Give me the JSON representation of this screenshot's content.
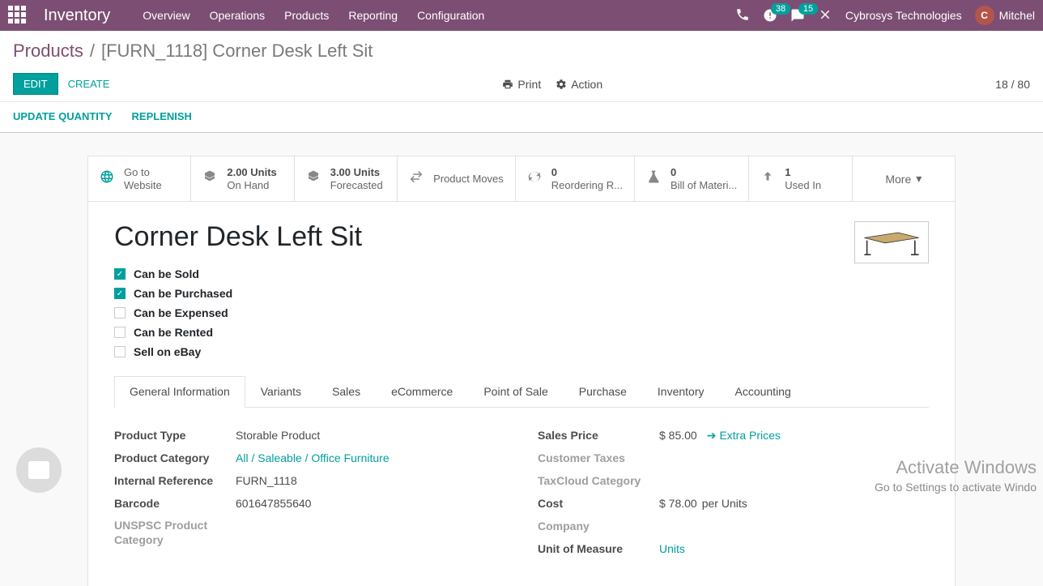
{
  "navbar": {
    "brand": "Inventory",
    "menu": [
      "Overview",
      "Operations",
      "Products",
      "Reporting",
      "Configuration"
    ],
    "activity_count": "38",
    "msg_count": "15",
    "company": "Cybrosys Technologies",
    "user": "Mitchel"
  },
  "breadcrumb": {
    "root": "Products",
    "current": "[FURN_1118] Corner Desk Left Sit"
  },
  "toolbar": {
    "edit": "EDIT",
    "create": "CREATE",
    "print": "Print",
    "action": "Action",
    "pager": "18 / 80"
  },
  "actions": {
    "update_qty": "UPDATE QUANTITY",
    "replenish": "REPLENISH"
  },
  "stats": {
    "website": {
      "line1": "Go to",
      "line2": "Website"
    },
    "onhand": {
      "line1": "2.00 Units",
      "line2": "On Hand"
    },
    "forecast": {
      "line1": "3.00 Units",
      "line2": "Forecasted"
    },
    "moves": {
      "label": "Product Moves"
    },
    "reorder": {
      "line1": "0",
      "line2": "Reordering R..."
    },
    "bom": {
      "line1": "0",
      "line2": "Bill of Materi..."
    },
    "usedin": {
      "line1": "1",
      "line2": "Used In"
    },
    "more": "More"
  },
  "product": {
    "title": "Corner Desk Left Sit",
    "checks": {
      "sold": "Can be Sold",
      "purchased": "Can be Purchased",
      "expensed": "Can be Expensed",
      "rented": "Can be Rented",
      "ebay": "Sell on eBay"
    }
  },
  "tabs": [
    "General Information",
    "Variants",
    "Sales",
    "eCommerce",
    "Point of Sale",
    "Purchase",
    "Inventory",
    "Accounting"
  ],
  "form": {
    "left": {
      "product_type": {
        "label": "Product Type",
        "value": "Storable Product"
      },
      "category": {
        "label": "Product Category",
        "value": "All / Saleable / Office Furniture"
      },
      "internal_ref": {
        "label": "Internal Reference",
        "value": "FURN_1118"
      },
      "barcode": {
        "label": "Barcode",
        "value": "601647855640"
      },
      "unspsc": {
        "label": "UNSPSC Product Category",
        "value": ""
      }
    },
    "right": {
      "sales_price": {
        "label": "Sales Price",
        "value": "$ 85.00",
        "extra": "Extra Prices"
      },
      "cust_tax": {
        "label": "Customer Taxes",
        "value": ""
      },
      "taxcloud": {
        "label": "TaxCloud Category",
        "value": ""
      },
      "cost": {
        "label": "Cost",
        "value": "$ 78.00",
        "suffix": "per Units"
      },
      "company": {
        "label": "Company",
        "value": ""
      },
      "uom": {
        "label": "Unit of Measure",
        "value": "Units"
      }
    }
  },
  "watermark": {
    "title": "Activate Windows",
    "sub": "Go to Settings to activate Windo"
  }
}
